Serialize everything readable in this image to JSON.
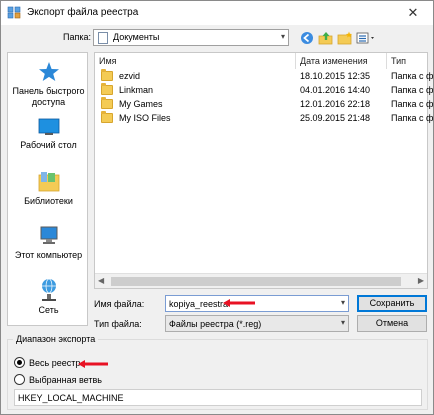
{
  "window": {
    "title": "Экспорт файла реестра",
    "close_glyph": "✕"
  },
  "folder": {
    "label": "Папка:",
    "current": "Документы"
  },
  "toolbar": {
    "icons": [
      "back-icon",
      "up-folder-icon",
      "new-folder-icon",
      "view-menu-icon"
    ]
  },
  "places": [
    {
      "label": "Панель быстрого доступа",
      "icon": "star-icon"
    },
    {
      "label": "Рабочий стол",
      "icon": "desktop-icon"
    },
    {
      "label": "Библиотеки",
      "icon": "libraries-icon"
    },
    {
      "label": "Этот компьютер",
      "icon": "computer-icon"
    },
    {
      "label": "Сеть",
      "icon": "network-icon"
    }
  ],
  "file_list": {
    "columns": [
      "Имя",
      "Дата изменения",
      "Тип"
    ],
    "rows": [
      {
        "name": "ezvid",
        "date": "18.10.2015 12:35",
        "type": "Папка с ф"
      },
      {
        "name": "Linkman",
        "date": "04.01.2016 14:40",
        "type": "Папка с ф"
      },
      {
        "name": "My Games",
        "date": "12.01.2016 22:18",
        "type": "Папка с ф"
      },
      {
        "name": "My ISO Files",
        "date": "25.09.2015 21:48",
        "type": "Папка с ф"
      }
    ]
  },
  "filename": {
    "label": "Имя файла:",
    "value": "kopiya_reestra"
  },
  "filetype": {
    "label": "Тип файла:",
    "value": "Файлы реестра (*.reg)"
  },
  "buttons": {
    "save": "Сохранить",
    "cancel": "Отмена"
  },
  "export_range": {
    "title": "Диапазон экспорта",
    "option_all": "Весь реестр",
    "option_branch": "Выбранная ветвь",
    "selected": "option_all",
    "branch_value": "HKEY_LOCAL_MACHINE"
  },
  "colors": {
    "accent": "#0078d7",
    "highlight_arrow": "#e81123",
    "folder": "#f4cb55"
  }
}
